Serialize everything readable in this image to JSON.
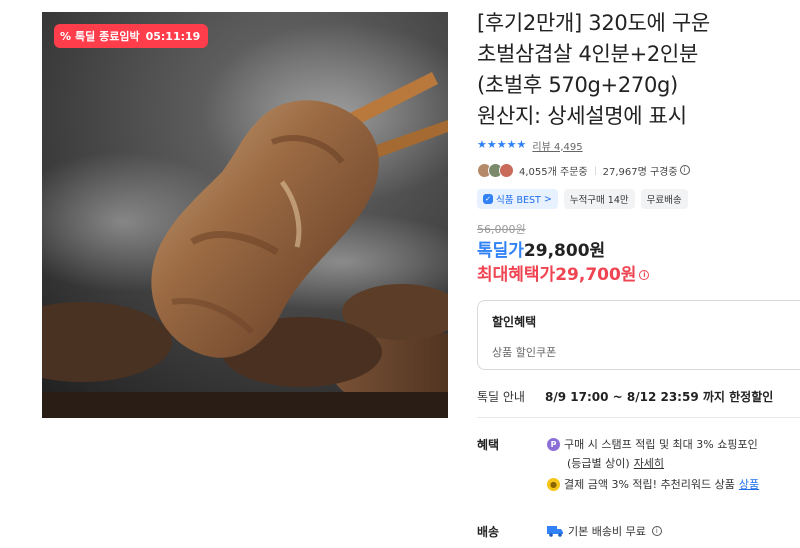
{
  "product": {
    "deal_badge": {
      "icon": "percent-icon",
      "label": "톡딜 종료임박",
      "timer": "05:11:19",
      "color": "#ff3d4b"
    },
    "title_lines": [
      "[후기2만개] 320도에 구운",
      "초벌삼겹살 4인분+2인분",
      "(초벌후 570g+270g)",
      "원산지: 상세설명에 표시"
    ],
    "rating": {
      "stars": 5,
      "review_label": "리뷰 4,495",
      "star_color": "#3182f6"
    },
    "buyers": {
      "orders": "4,055개 주문중",
      "subscribers": "27,967명 구경중"
    },
    "tags": [
      {
        "label": "식품 BEST",
        "suffix": ">",
        "kind": "best"
      },
      {
        "label": "누적구매 14만",
        "kind": "plain"
      },
      {
        "label": "무료배송",
        "kind": "plain"
      }
    ],
    "price": {
      "original": "56,000원",
      "deal_label": "톡딜가",
      "deal_value": "29,800원",
      "max_label": "최대혜택가",
      "max_value": "29,700원"
    },
    "discount_box": {
      "heading": "할인혜택",
      "item": "상품 할인쿠폰"
    },
    "deal_info": {
      "label": "톡딜 안내",
      "period": "8/9 17:00 ~ 8/12 23:59 까지 한정할인"
    },
    "benefit": {
      "label": "혜택",
      "line1": "구매 시 스탬프 적립 및 최대 3% 쇼핑포인",
      "line1_sub": "(등급별 상이)",
      "line1_link": "자세히",
      "line2": "결제 금액 3% 적립! 추천리워드 상품",
      "line2_link": "상품"
    },
    "shipping": {
      "label": "배송",
      "text": "기본 배송비 무료"
    }
  }
}
